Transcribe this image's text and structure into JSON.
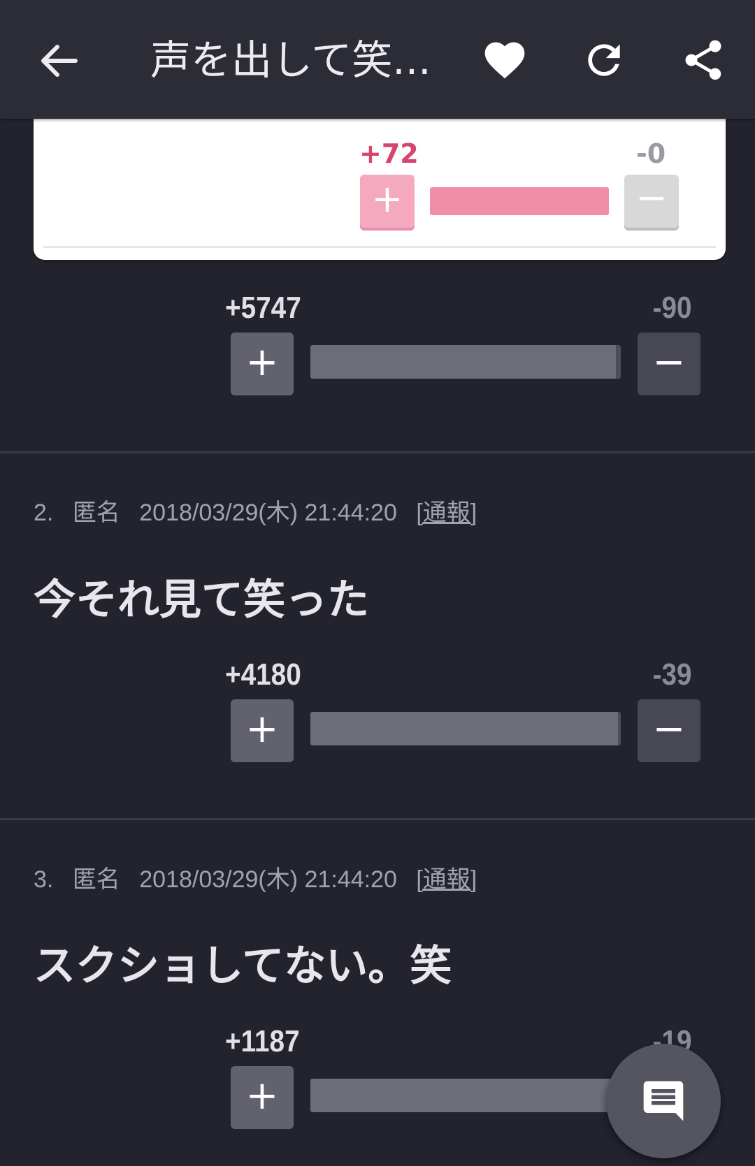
{
  "app_bar": {
    "title": "声を出して笑...",
    "icons": [
      "back-arrow-icon",
      "heart-icon",
      "refresh-icon",
      "share-icon"
    ]
  },
  "first_card": {
    "plus_count": "+72",
    "minus_count": "-0",
    "plus_label": "+",
    "minus_label": "−",
    "ratio": 1.0
  },
  "comments": [
    {
      "votes": {
        "plus_count": "+5747",
        "minus_count": "-90",
        "ratio": 0.985
      }
    },
    {
      "number": "2.",
      "author": "匿名",
      "datetime": "2018/03/29(木) 21:44:20",
      "report": "[通報]",
      "text": "今それ見て笑った",
      "votes": {
        "plus_count": "+4180",
        "minus_count": "-39",
        "ratio": 0.99
      }
    },
    {
      "number": "3.",
      "author": "匿名",
      "datetime": "2018/03/29(木) 21:44:20",
      "report": "[通報]",
      "text": "スクショしてない。笑",
      "votes": {
        "plus_count": "+1187",
        "minus_count": "-19",
        "ratio": 0.984
      }
    }
  ],
  "vote_buttons": {
    "plus": "+",
    "minus": "−"
  },
  "fab": {
    "icon": "comment-icon"
  },
  "colors": {
    "background": "#23232e",
    "app_bar": "#2c2c37",
    "pink_accent": "#d4466e",
    "pink_bar": "#f08eaa"
  }
}
